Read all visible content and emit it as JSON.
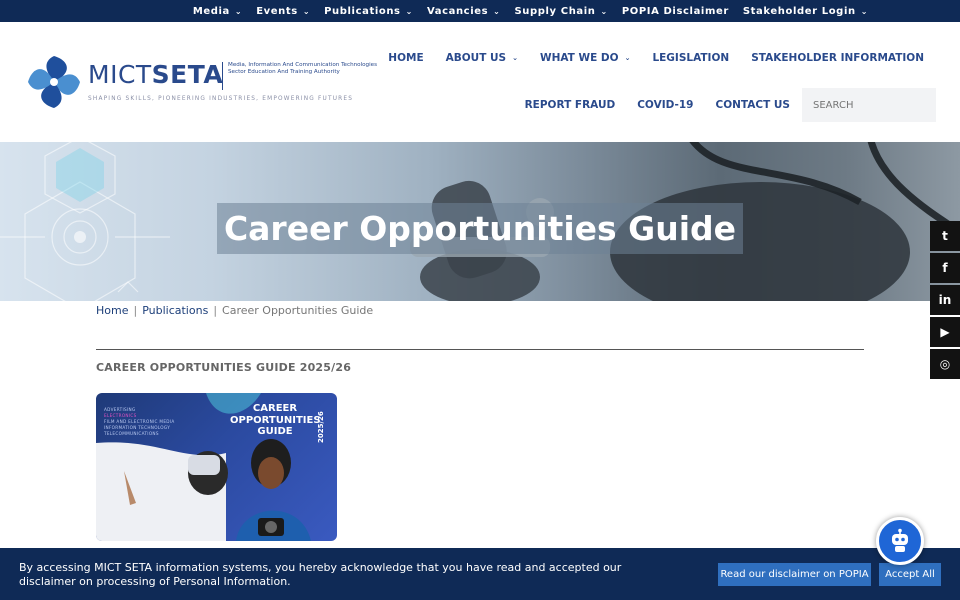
{
  "topbar": {
    "items": [
      {
        "label": "Media",
        "dropdown": true
      },
      {
        "label": "Events",
        "dropdown": true
      },
      {
        "label": "Publications",
        "dropdown": true
      },
      {
        "label": "Vacancies",
        "dropdown": true
      },
      {
        "label": "Supply Chain",
        "dropdown": true
      },
      {
        "label": "POPIA Disclaimer",
        "dropdown": false
      },
      {
        "label": "Stakeholder Login",
        "dropdown": true
      }
    ]
  },
  "logo": {
    "mict": "MICT",
    "seta": "SETA",
    "subtitle": "Media, Information And Communication Technologies Sector Education And Training Authority",
    "tagline": "SHAPING SKILLS, PIONEERING INDUSTRIES, EMPOWERING FUTURES"
  },
  "nav": {
    "row1": [
      {
        "label": "HOME",
        "dropdown": false
      },
      {
        "label": "ABOUT US",
        "dropdown": true
      },
      {
        "label": "WHAT WE DO",
        "dropdown": true
      },
      {
        "label": "LEGISLATION",
        "dropdown": false
      },
      {
        "label": "STAKEHOLDER INFORMATION",
        "dropdown": false
      }
    ],
    "row2": [
      {
        "label": "REPORT FRAUD"
      },
      {
        "label": "COVID-19"
      },
      {
        "label": "CONTACT US"
      }
    ],
    "search_placeholder": "SEARCH"
  },
  "hero": {
    "title": "Career Opportunities Guide"
  },
  "breadcrumb": {
    "home": "Home",
    "publications": "Publications",
    "current": "Career Opportunities Guide",
    "separator": "|"
  },
  "section": {
    "title": "CAREER OPPORTUNITIES GUIDE 2025/26"
  },
  "card": {
    "title": "CAREER OPPORTUNITIES GUIDE",
    "year": "2025/26",
    "list": [
      "ADVERTISING",
      "ELECTRONICS",
      "FILM AND ELECTRONIC MEDIA",
      "INFORMATION TECHNOLOGY",
      "TELECOMMUNICATIONS"
    ]
  },
  "social": {
    "items": [
      {
        "name": "twitter-icon",
        "glyph": "t"
      },
      {
        "name": "facebook-icon",
        "glyph": "f"
      },
      {
        "name": "linkedin-icon",
        "glyph": "in"
      },
      {
        "name": "youtube-icon",
        "glyph": "▶"
      },
      {
        "name": "instagram-icon",
        "glyph": "◎"
      }
    ]
  },
  "cookie": {
    "text": "By accessing MICT SETA information systems, you hereby acknowledge that you have read and accepted our disclaimer on processing of Personal Information.",
    "disclaimer_label": "Read our disclaimer on POPIA",
    "accept_label": "Accept All"
  },
  "colors": {
    "navy": "#0f2a56",
    "brand_blue": "#2a4a8c",
    "button_blue": "#2f6fbf",
    "chatbot_blue": "#1f66d6"
  }
}
